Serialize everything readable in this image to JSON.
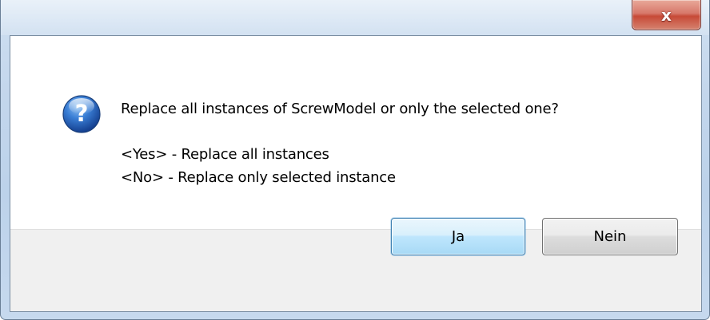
{
  "window": {
    "close_symbol": "x",
    "close_icon": "close-icon"
  },
  "dialog": {
    "icon": "question-icon",
    "icon_glyph": "?",
    "question": "Replace all instances of ScrewModel or only the selected one?",
    "option_yes": "<Yes> - Replace all instances",
    "option_no": "<No> - Replace only selected instance"
  },
  "buttons": {
    "yes_label": "Ja",
    "no_label": "Nein"
  },
  "colors": {
    "frame": "#c3d6ec",
    "close_button": "#c74a37",
    "default_button_border": "#3c7fb1",
    "icon_blue": "#1f5fb8"
  }
}
